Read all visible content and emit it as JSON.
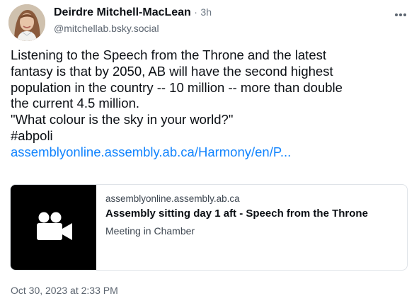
{
  "post": {
    "author": {
      "display_name": "Deirdre Mitchell-MacLean",
      "separator": "·",
      "relative_time": "3h",
      "handle": "@mitchellab.bsky.social"
    },
    "more_icon": "ellipsis-icon",
    "text_lines": [
      "Listening to the Speech from the Throne and the latest",
      "fantasy is that by 2050, AB will have the second highest",
      "population in the country -- 10 million -- more than double",
      "the current 4.5 million.",
      "\"What colour is the sky in your world?\"",
      "#abpoli"
    ],
    "link_text": "assemblyonline.assembly.ab.ca/Harmony/en/P...",
    "embed": {
      "thumbnail_icon": "video-camera-icon",
      "domain": "assemblyonline.assembly.ab.ca",
      "title": "Assembly sitting day 1 aft - Speech from the Throne",
      "description": "Meeting in Chamber"
    },
    "timestamp": "Oct 30, 2023 at 2:33 PM"
  },
  "colors": {
    "link": "#1083fe",
    "text": "#0b0f14",
    "muted": "#5c6570",
    "card_border": "#dfe3e8",
    "thumbnail_bg": "#000000"
  }
}
